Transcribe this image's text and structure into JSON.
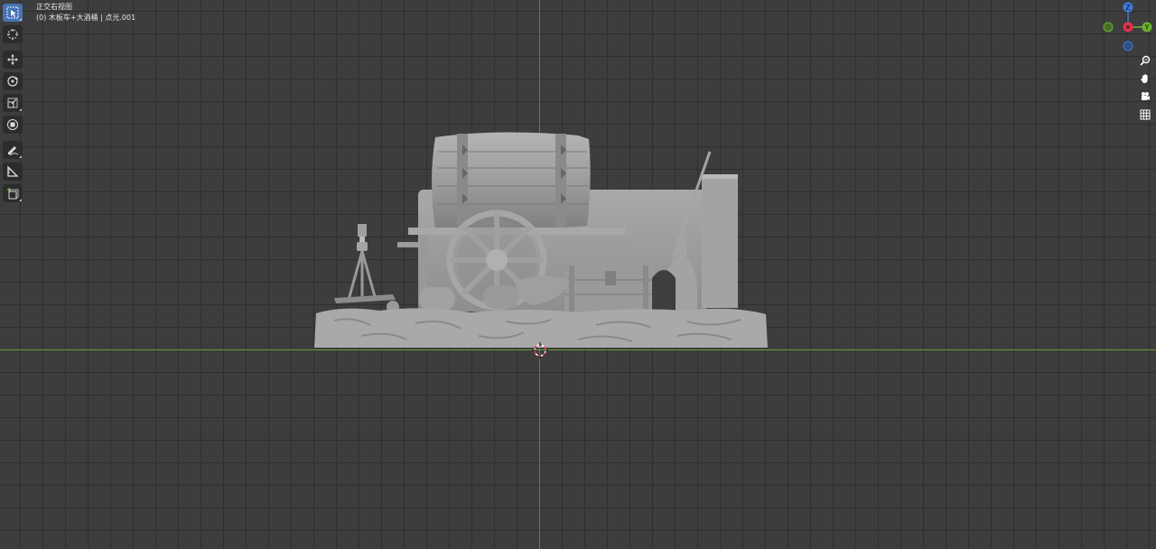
{
  "viewport": {
    "view_name": "正交右视图",
    "context": "(0) 木板车+大酒桶 | 点光.001"
  },
  "toolbar": {
    "tools": [
      {
        "name": "select-box",
        "active": true
      },
      {
        "name": "cursor",
        "active": false
      },
      {
        "name": "move",
        "active": false
      },
      {
        "name": "rotate",
        "active": false
      },
      {
        "name": "scale",
        "active": false
      },
      {
        "name": "transform",
        "active": false
      },
      {
        "name": "annotate",
        "active": false
      },
      {
        "name": "measure",
        "active": false
      },
      {
        "name": "add-cube",
        "active": false
      }
    ]
  },
  "gizmo": {
    "z_label": "Z",
    "y_label": "Y",
    "x_color": "#e8324c",
    "y_color": "#6ab42c",
    "z_color": "#3f7be0"
  },
  "nav_buttons": [
    "zoom-icon",
    "pan-hand-icon",
    "camera-icon",
    "grid-icon"
  ],
  "colors": {
    "background": "#3d3d3d",
    "grid": "#2f2f2f",
    "axis_z": "#4a6fb5",
    "axis_y": "#6d9a3a",
    "active_tool": "#4772b3",
    "model": "#9a9a9a"
  }
}
